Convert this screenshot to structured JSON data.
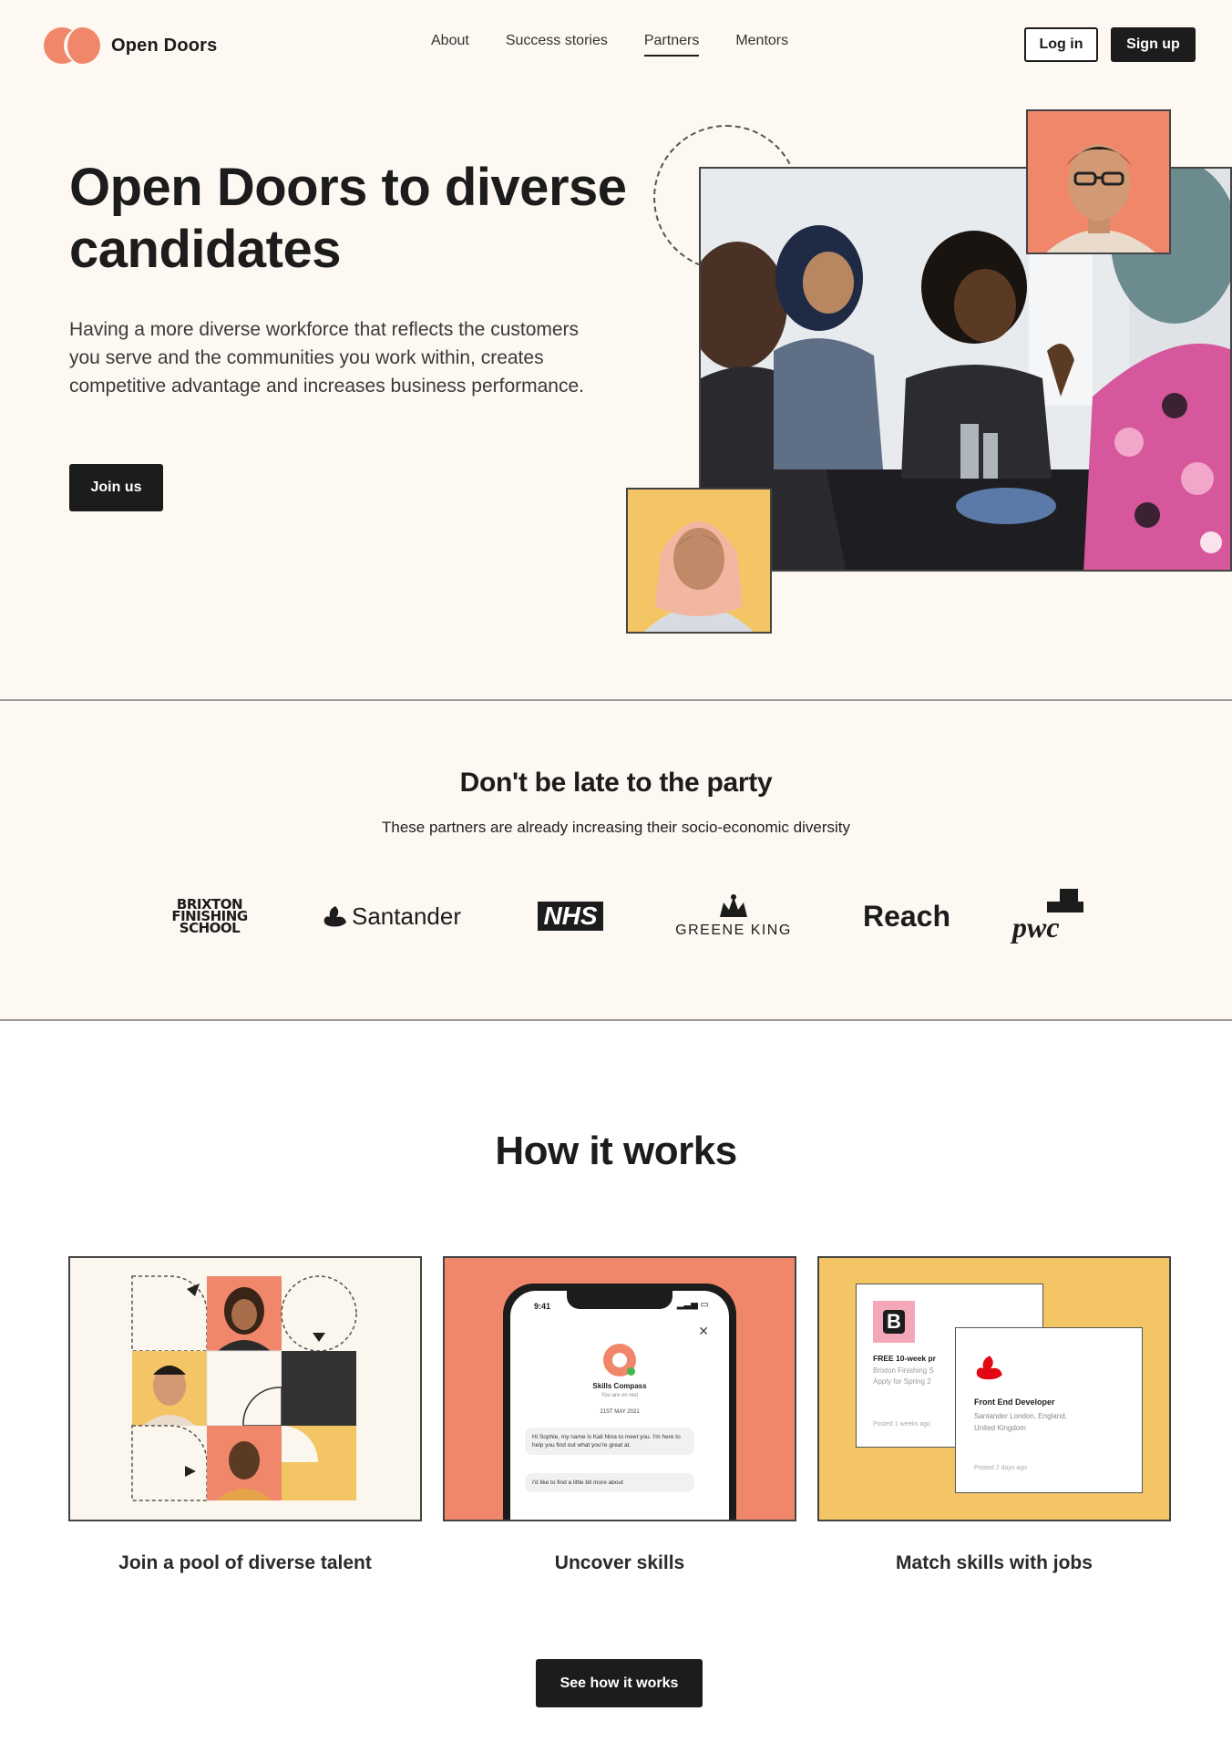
{
  "header": {
    "logo_text": "Open Doors",
    "nav": [
      {
        "label": "About",
        "active": false
      },
      {
        "label": "Success stories",
        "active": false
      },
      {
        "label": "Partners",
        "active": true
      },
      {
        "label": "Mentors",
        "active": false
      }
    ],
    "login_label": "Log in",
    "signup_label": "Sign up"
  },
  "hero": {
    "title": "Open Doors to diverse candidates",
    "text": "Having a more diverse workforce that reflects the customers you serve and the communities you work within, creates competitive advantage and increases business performance.",
    "cta_label": "Join us"
  },
  "partners": {
    "title": "Don't be late to the party",
    "subtitle": "These partners are already increasing their socio-economic diversity",
    "logos": [
      {
        "name": "BRIXTON FINISHING SCHOOL",
        "line1": "BRIXTON",
        "line2": "FINISHING",
        "line3": "SCHOOL"
      },
      {
        "name": "Santander"
      },
      {
        "name": "NHS"
      },
      {
        "name": "GREENE KING"
      },
      {
        "name": "Reach"
      },
      {
        "name": "pwc"
      }
    ]
  },
  "how": {
    "title": "How it works",
    "steps": [
      {
        "label": "Join a pool of diverse talent"
      },
      {
        "label": "Uncover skills"
      },
      {
        "label": "Match skills with jobs"
      }
    ],
    "phone": {
      "time": "9:41",
      "app_name": "Skills Compass",
      "app_sub": "You are on rest",
      "date": "21ST MAY 2021",
      "msg1": "Hi Sophie, my name is Kali Nina to meet you. I'm here to help you find out what you're great at.",
      "msg2": "I'd like to find a little bit more about"
    },
    "jobs": [
      {
        "logo_letter": "B",
        "title": "FREE 10-week pr",
        "company": "Brixton Finishing S",
        "detail": "Apply for Spring 2",
        "posted": "Posted 1 weeks ago"
      },
      {
        "title": "Front End Developer",
        "company": "Santander London, England,",
        "detail": "United Kingdom",
        "posted": "Posted 2 days ago"
      }
    ],
    "cta_label": "See how it works"
  },
  "colors": {
    "background": "#fdf8f1",
    "accent_coral": "#f0876a",
    "accent_yellow": "#f3c564",
    "dark": "#1c1c1c"
  }
}
